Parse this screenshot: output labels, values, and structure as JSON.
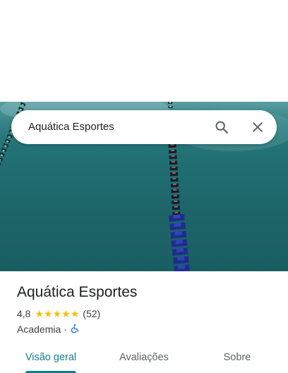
{
  "search": {
    "query": "Aquática Esportes",
    "search_icon": "search-icon",
    "close_icon": "close-icon"
  },
  "place": {
    "name": "Aquática Esportes",
    "rating": "4,8",
    "stars": 5,
    "review_count": "(52)",
    "category": "Academia",
    "separator": "·",
    "accessibility_icon": "wheelchair-icon"
  },
  "tabs": [
    {
      "label": "Visão geral",
      "active": true
    },
    {
      "label": "Avaliações",
      "active": false
    },
    {
      "label": "Sobre",
      "active": false
    }
  ],
  "colors": {
    "accent": "#137c8b",
    "star": "#fbbc04",
    "accessibility": "#1a73e8",
    "pool_water": "#1f6e72"
  }
}
